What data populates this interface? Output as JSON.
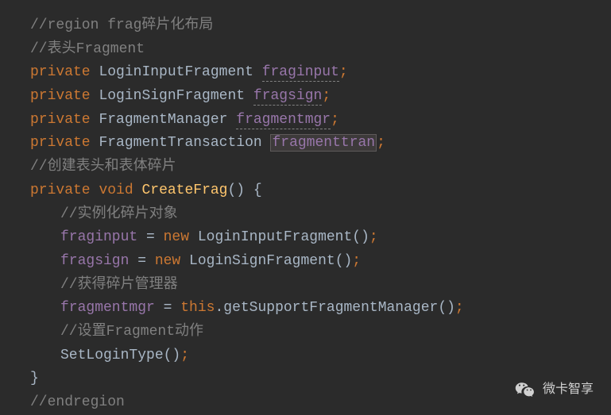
{
  "code": {
    "comment_region": "//region frag碎片化布局",
    "comment_header": "//表头Fragment",
    "kw_private": "private",
    "kw_void": "void",
    "kw_new": "new",
    "kw_this": "this",
    "type_login_input": "LoginInputFragment",
    "type_login_sign": "LoginSignFragment",
    "type_frag_mgr": "FragmentManager",
    "type_frag_tran": "FragmentTransaction",
    "field_fraginput": "fraginput",
    "field_fragsign": "fragsign",
    "field_fragmentmgr": "fragmentmgr",
    "field_fragmenttran": "fragmenttran",
    "comment_create": "//创建表头和表体碎片",
    "method_createfrag": "CreateFrag",
    "comment_instance": "//实例化碎片对象",
    "comment_getmgr": "//获得碎片管理器",
    "method_getsupport": "getSupportFragmentManager",
    "comment_setfrag": "//设置Fragment动作",
    "method_setlogin": "SetLoginType",
    "comment_endregion": "//endregion",
    "semi": ";",
    "eq": " = ",
    "dot": ".",
    "open_brace": " {",
    "close_brace": "}",
    "parens": "()",
    "space": " "
  },
  "branding": {
    "text": "微卡智享"
  }
}
